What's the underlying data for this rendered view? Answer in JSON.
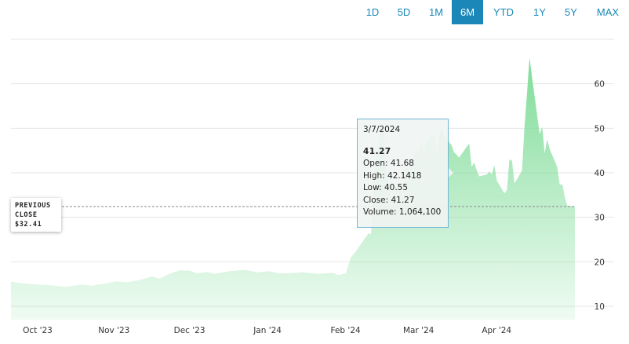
{
  "ranges": [
    {
      "label": "1D",
      "active": false
    },
    {
      "label": "5D",
      "active": false
    },
    {
      "label": "1M",
      "active": false
    },
    {
      "label": "6M",
      "active": true
    },
    {
      "label": "YTD",
      "active": false
    },
    {
      "label": "1Y",
      "active": false
    },
    {
      "label": "5Y",
      "active": false
    },
    {
      "label": "MAX",
      "active": false
    }
  ],
  "previous_close": {
    "line1": "PREVIOUS",
    "line2": "CLOSE",
    "value": "$32.41"
  },
  "tooltip": {
    "date": "3/7/2024",
    "price": "41.27",
    "open": "Open: 41.68",
    "high": "High: 42.1418",
    "low": "Low: 40.55",
    "close": "Close: 41.27",
    "volume": "Volume: 1,064,100"
  },
  "colors": {
    "accent": "#1a87b8",
    "area_fill": "#7fdc98",
    "grid": "#e6e6e6"
  },
  "chart_data": {
    "type": "area",
    "previous_close": 32.41,
    "y_ticks": [
      10,
      20,
      30,
      40,
      50,
      60
    ],
    "x_ticks": [
      "Oct '23",
      "Nov '23",
      "Dec '23",
      "Jan '24",
      "Feb '24",
      "Mar '24",
      "Apr '24"
    ],
    "ylim": [
      7,
      70
    ],
    "grid": "horizontal",
    "series": [
      {
        "points": [
          [
            "2023-10-02",
            15.5
          ],
          [
            "2023-10-06",
            15.2
          ],
          [
            "2023-10-12",
            14.9
          ],
          [
            "2023-10-18",
            14.7
          ],
          [
            "2023-10-24",
            14.4
          ],
          [
            "2023-10-30",
            14.9
          ],
          [
            "2023-11-03",
            14.6
          ],
          [
            "2023-11-08",
            15.1
          ],
          [
            "2023-11-13",
            15.6
          ],
          [
            "2023-11-17",
            15.4
          ],
          [
            "2023-11-22",
            15.9
          ],
          [
            "2023-11-27",
            16.7
          ],
          [
            "2023-11-30",
            16.2
          ],
          [
            "2023-12-04",
            17.3
          ],
          [
            "2023-12-08",
            18.1
          ],
          [
            "2023-12-12",
            18.0
          ],
          [
            "2023-12-15",
            17.4
          ],
          [
            "2023-12-19",
            17.7
          ],
          [
            "2023-12-22",
            17.3
          ],
          [
            "2023-12-28",
            17.9
          ],
          [
            "2024-01-03",
            18.2
          ],
          [
            "2024-01-08",
            17.6
          ],
          [
            "2024-01-12",
            17.9
          ],
          [
            "2024-01-17",
            17.4
          ],
          [
            "2024-01-22",
            17.5
          ],
          [
            "2024-01-26",
            17.6
          ],
          [
            "2024-02-01",
            17.3
          ],
          [
            "2024-02-07",
            17.5
          ],
          [
            "2024-02-09",
            17.0
          ],
          [
            "2024-02-12",
            17.4
          ],
          [
            "2024-02-14",
            21.0
          ],
          [
            "2024-02-16",
            22.3
          ],
          [
            "2024-02-19",
            24.8
          ],
          [
            "2024-02-21",
            26.4
          ],
          [
            "2024-02-22",
            26.2
          ],
          [
            "2024-02-23",
            39.0
          ],
          [
            "2024-02-26",
            50.0
          ],
          [
            "2024-02-27",
            50.6
          ],
          [
            "2024-02-28",
            41.0
          ],
          [
            "2024-02-29",
            37.4
          ],
          [
            "2024-03-01",
            34.5
          ],
          [
            "2024-03-04",
            37.3
          ],
          [
            "2024-03-05",
            35.8
          ],
          [
            "2024-03-06",
            37.6
          ],
          [
            "2024-03-07",
            41.27
          ],
          [
            "2024-03-08",
            40.5
          ],
          [
            "2024-03-11",
            45.1
          ],
          [
            "2024-03-12",
            43.6
          ],
          [
            "2024-03-13",
            46.8
          ],
          [
            "2024-03-14",
            44.2
          ],
          [
            "2024-03-15",
            47.0
          ],
          [
            "2024-03-18",
            48.7
          ],
          [
            "2024-03-19",
            44.3
          ],
          [
            "2024-03-20",
            47.4
          ],
          [
            "2024-03-21",
            50.0
          ],
          [
            "2024-03-22",
            48.4
          ],
          [
            "2024-03-25",
            46.2
          ],
          [
            "2024-03-26",
            44.6
          ],
          [
            "2024-03-27",
            44.1
          ],
          [
            "2024-03-28",
            43.4
          ],
          [
            "2024-04-01",
            46.6
          ],
          [
            "2024-04-02",
            41.3
          ],
          [
            "2024-04-03",
            42.3
          ],
          [
            "2024-04-04",
            40.6
          ],
          [
            "2024-04-05",
            39.2
          ],
          [
            "2024-04-08",
            39.6
          ],
          [
            "2024-04-09",
            40.3
          ],
          [
            "2024-04-10",
            39.6
          ],
          [
            "2024-04-11",
            41.7
          ],
          [
            "2024-04-12",
            38.2
          ],
          [
            "2024-04-15",
            35.4
          ],
          [
            "2024-04-16",
            36.1
          ],
          [
            "2024-04-17",
            43.0
          ],
          [
            "2024-04-18",
            42.7
          ],
          [
            "2024-04-19",
            37.6
          ],
          [
            "2024-04-22",
            40.5
          ],
          [
            "2024-04-23",
            50.5
          ],
          [
            "2024-04-24",
            58.0
          ],
          [
            "2024-04-25",
            65.8
          ],
          [
            "2024-04-26",
            61.4
          ],
          [
            "2024-04-29",
            48.7
          ],
          [
            "2024-04-30",
            50.3
          ],
          [
            "2024-05-01",
            44.4
          ],
          [
            "2024-05-02",
            47.5
          ],
          [
            "2024-05-03",
            45.3
          ],
          [
            "2024-05-06",
            41.3
          ],
          [
            "2024-05-07",
            37.3
          ],
          [
            "2024-05-08",
            37.4
          ],
          [
            "2024-05-09",
            34.5
          ],
          [
            "2024-05-10",
            32.6
          ],
          [
            "2024-05-13",
            32.41
          ]
        ]
      }
    ]
  }
}
